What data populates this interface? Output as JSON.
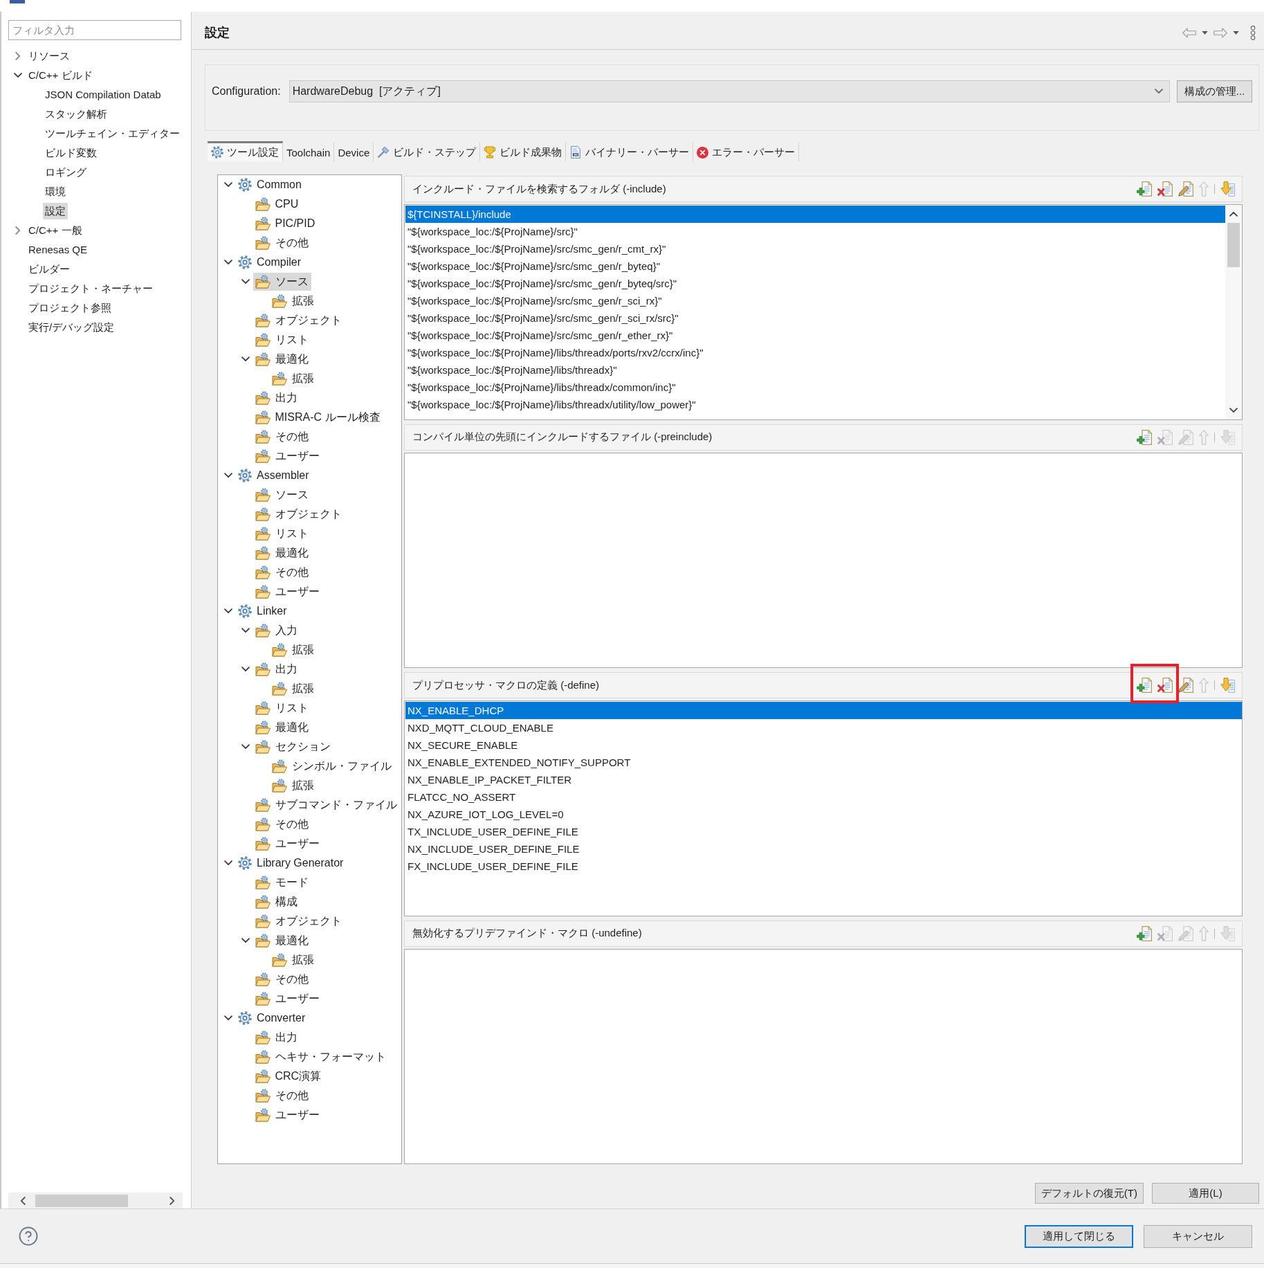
{
  "sidebar": {
    "filter": {
      "placeholder": "フィルタ入力"
    },
    "items": [
      {
        "label": "リソース",
        "expanded": false,
        "selected": false
      },
      {
        "label": "C/C++ ビルド",
        "expanded": true,
        "selected": false,
        "children": [
          {
            "label": "JSON Compilation Datab",
            "selected": false
          },
          {
            "label": "スタック解析",
            "selected": false
          },
          {
            "label": "ツールチェイン・エディター",
            "selected": false
          },
          {
            "label": "ビルド変数",
            "selected": false
          },
          {
            "label": "ロギング",
            "selected": false
          },
          {
            "label": "環境",
            "selected": false
          },
          {
            "label": "設定",
            "selected": true
          }
        ]
      },
      {
        "label": "C/C++ 一般",
        "expanded": false,
        "selected": false
      },
      {
        "label": "Renesas QE",
        "selected": false
      },
      {
        "label": "ビルダー",
        "selected": false
      },
      {
        "label": "プロジェクト・ネーチャー",
        "selected": false
      },
      {
        "label": "プロジェクト参照",
        "selected": false
      },
      {
        "label": "実行/デバッグ設定",
        "selected": false
      }
    ]
  },
  "page": {
    "title": "設定"
  },
  "configuration": {
    "label": "Configuration:",
    "value": "HardwareDebug  [アクティブ]",
    "manage_button": "構成の管理..."
  },
  "tabs": [
    {
      "label": "ツール設定",
      "selected": true
    },
    {
      "label": "Toolchain",
      "selected": false
    },
    {
      "label": "Device",
      "selected": false
    },
    {
      "label": "ビルド・ステップ",
      "selected": false
    },
    {
      "label": "ビルド成果物",
      "selected": false
    },
    {
      "label": "バイナリー・パーサー",
      "selected": false
    },
    {
      "label": "エラー・パーサー",
      "selected": false
    }
  ],
  "tool_tree": [
    {
      "label": "Common",
      "expanded": true,
      "selected": false,
      "children": [
        {
          "label": "CPU",
          "selected": false
        },
        {
          "label": "PIC/PID",
          "selected": false
        },
        {
          "label": "その他",
          "selected": false
        }
      ]
    },
    {
      "label": "Compiler",
      "expanded": true,
      "selected": false,
      "children": [
        {
          "label": "ソース",
          "expanded": true,
          "selected": true,
          "children": [
            {
              "label": "拡張",
              "selected": false
            }
          ]
        },
        {
          "label": "オブジェクト",
          "selected": false
        },
        {
          "label": "リスト",
          "selected": false
        },
        {
          "label": "最適化",
          "expanded": true,
          "selected": false,
          "children": [
            {
              "label": "拡張",
              "selected": false
            }
          ]
        },
        {
          "label": "出力",
          "selected": false
        },
        {
          "label": "MISRA-C ルール検査",
          "selected": false
        },
        {
          "label": "その他",
          "selected": false
        },
        {
          "label": "ユーザー",
          "selected": false
        }
      ]
    },
    {
      "label": "Assembler",
      "expanded": true,
      "selected": false,
      "children": [
        {
          "label": "ソース",
          "selected": false
        },
        {
          "label": "オブジェクト",
          "selected": false
        },
        {
          "label": "リスト",
          "selected": false
        },
        {
          "label": "最適化",
          "selected": false
        },
        {
          "label": "その他",
          "selected": false
        },
        {
          "label": "ユーザー",
          "selected": false
        }
      ]
    },
    {
      "label": "Linker",
      "expanded": true,
      "selected": false,
      "children": [
        {
          "label": "入力",
          "expanded": true,
          "selected": false,
          "children": [
            {
              "label": "拡張",
              "selected": false
            }
          ]
        },
        {
          "label": "出力",
          "expanded": true,
          "selected": false,
          "children": [
            {
              "label": "拡張",
              "selected": false
            }
          ]
        },
        {
          "label": "リスト",
          "selected": false
        },
        {
          "label": "最適化",
          "selected": false
        },
        {
          "label": "セクション",
          "expanded": true,
          "selected": false,
          "children": [
            {
              "label": "シンボル・ファイル",
              "selected": false
            },
            {
              "label": "拡張",
              "selected": false
            }
          ]
        },
        {
          "label": "サブコマンド・ファイル",
          "selected": false
        },
        {
          "label": "その他",
          "selected": false
        },
        {
          "label": "ユーザー",
          "selected": false
        }
      ]
    },
    {
      "label": "Library Generator",
      "expanded": true,
      "selected": false,
      "children": [
        {
          "label": "モード",
          "selected": false
        },
        {
          "label": "構成",
          "selected": false
        },
        {
          "label": "オブジェクト",
          "selected": false
        },
        {
          "label": "最適化",
          "expanded": true,
          "selected": false,
          "children": [
            {
              "label": "拡張",
              "selected": false
            }
          ]
        },
        {
          "label": "その他",
          "selected": false
        },
        {
          "label": "ユーザー",
          "selected": false
        }
      ]
    },
    {
      "label": "Converter",
      "expanded": true,
      "selected": false,
      "children": [
        {
          "label": "出力",
          "selected": false
        },
        {
          "label": "ヘキサ・フォーマット",
          "selected": false
        },
        {
          "label": "CRC演算",
          "selected": false
        },
        {
          "label": "その他",
          "selected": false
        },
        {
          "label": "ユーザー",
          "selected": false
        }
      ]
    }
  ],
  "sections": [
    {
      "title": "インクルード・ファイルを検索するフォルダ (-include)",
      "scrollbar": true,
      "tools": [
        {
          "kind": "add",
          "disabled": false,
          "highlighted": false
        },
        {
          "kind": "delete",
          "disabled": false,
          "highlighted": false
        },
        {
          "kind": "edit",
          "disabled": false,
          "highlighted": false
        },
        {
          "kind": "up",
          "disabled": true,
          "highlighted": false
        },
        {
          "kind": "down",
          "disabled": false,
          "highlighted": false
        }
      ],
      "rows": [
        {
          "text": "${TCINSTALL}/include",
          "selected": true
        },
        {
          "text": "\"${workspace_loc:/${ProjName}/src}\"",
          "selected": false
        },
        {
          "text": "\"${workspace_loc:/${ProjName}/src/smc_gen/r_cmt_rx}\"",
          "selected": false
        },
        {
          "text": "\"${workspace_loc:/${ProjName}/src/smc_gen/r_byteq}\"",
          "selected": false
        },
        {
          "text": "\"${workspace_loc:/${ProjName}/src/smc_gen/r_byteq/src}\"",
          "selected": false
        },
        {
          "text": "\"${workspace_loc:/${ProjName}/src/smc_gen/r_sci_rx}\"",
          "selected": false
        },
        {
          "text": "\"${workspace_loc:/${ProjName}/src/smc_gen/r_sci_rx/src}\"",
          "selected": false
        },
        {
          "text": "\"${workspace_loc:/${ProjName}/src/smc_gen/r_ether_rx}\"",
          "selected": false
        },
        {
          "text": "\"${workspace_loc:/${ProjName}/libs/threadx/ports/rxv2/ccrx/inc}\"",
          "selected": false
        },
        {
          "text": "\"${workspace_loc:/${ProjName}/libs/threadx}\"",
          "selected": false
        },
        {
          "text": "\"${workspace_loc:/${ProjName}/libs/threadx/common/inc}\"",
          "selected": false
        },
        {
          "text": "\"${workspace_loc:/${ProjName}/libs/threadx/utility/low_power}\"",
          "selected": false
        }
      ]
    },
    {
      "title": "コンパイル単位の先頭にインクルードするファイル (-preinclude)",
      "scrollbar": false,
      "tools": [
        {
          "kind": "add",
          "disabled": false,
          "highlighted": false
        },
        {
          "kind": "delete",
          "disabled": true,
          "highlighted": false
        },
        {
          "kind": "edit",
          "disabled": true,
          "highlighted": false
        },
        {
          "kind": "up",
          "disabled": true,
          "highlighted": false
        },
        {
          "kind": "down",
          "disabled": true,
          "highlighted": false
        }
      ]
    },
    {
      "title": "プリプロセッサ・マクロの定義 (-define)",
      "scrollbar": false,
      "tools": [
        {
          "kind": "add",
          "disabled": false,
          "highlighted": true
        },
        {
          "kind": "delete",
          "disabled": false,
          "highlighted": true
        },
        {
          "kind": "edit",
          "disabled": false,
          "highlighted": false
        },
        {
          "kind": "up",
          "disabled": true,
          "highlighted": false
        },
        {
          "kind": "down",
          "disabled": false,
          "highlighted": false
        }
      ],
      "rows": [
        {
          "text": "NX_ENABLE_DHCP",
          "selected": true
        },
        {
          "text": "NXD_MQTT_CLOUD_ENABLE",
          "selected": false
        },
        {
          "text": "NX_SECURE_ENABLE",
          "selected": false
        },
        {
          "text": "NX_ENABLE_EXTENDED_NOTIFY_SUPPORT",
          "selected": false
        },
        {
          "text": "NX_ENABLE_IP_PACKET_FILTER",
          "selected": false
        },
        {
          "text": "FLATCC_NO_ASSERT",
          "selected": false
        },
        {
          "text": "NX_AZURE_IOT_LOG_LEVEL=0",
          "selected": false
        },
        {
          "text": "TX_INCLUDE_USER_DEFINE_FILE",
          "selected": false
        },
        {
          "text": "NX_INCLUDE_USER_DEFINE_FILE",
          "selected": false
        },
        {
          "text": "FX_INCLUDE_USER_DEFINE_FILE",
          "selected": false
        }
      ]
    },
    {
      "title": "無効化するプリデファインド・マクロ (-undefine)",
      "scrollbar": false,
      "tools": [
        {
          "kind": "add",
          "disabled": false,
          "highlighted": false
        },
        {
          "kind": "delete",
          "disabled": true,
          "highlighted": false
        },
        {
          "kind": "edit",
          "disabled": true,
          "highlighted": false
        },
        {
          "kind": "up",
          "disabled": true,
          "highlighted": false
        },
        {
          "kind": "down",
          "disabled": true,
          "highlighted": false
        }
      ]
    }
  ],
  "actions": {
    "restore_defaults": "デフォルトの復元(T)",
    "apply": "適用(L)"
  },
  "footer": {
    "buttons": [
      {
        "label": "適用して閉じる",
        "default": true
      },
      {
        "label": "キャンセル",
        "default": false
      }
    ]
  }
}
